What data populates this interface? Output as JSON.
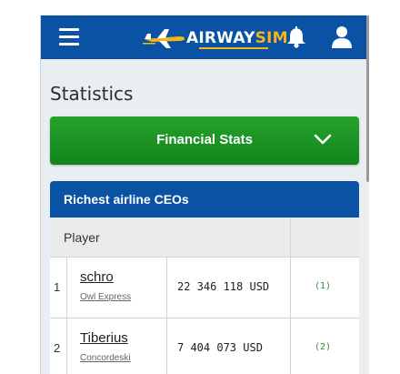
{
  "header": {
    "logo_prefix": "AIRWAY",
    "logo_accent": "SIM",
    "menu_icon": "hamburger-menu-icon",
    "notification_icon": "bell-icon",
    "profile_icon": "user-icon",
    "brand_color": "#0a52a4",
    "accent_color": "#f4b41a"
  },
  "page": {
    "title": "Statistics"
  },
  "stats_select": {
    "selected": "Financial Stats",
    "icon": "chevron-down-icon",
    "color": "#1e9626"
  },
  "card": {
    "title": "Richest airline CEOs",
    "columns": [
      "Player"
    ],
    "rows": [
      {
        "rank": "1",
        "player": "schro",
        "airline": "Owl Express",
        "amount": "22 346 118 USD",
        "change": "(1)"
      },
      {
        "rank": "2",
        "player": "Tiberius",
        "airline": "Concordeski",
        "amount": "7 404 073 USD",
        "change": "(2)"
      }
    ]
  }
}
